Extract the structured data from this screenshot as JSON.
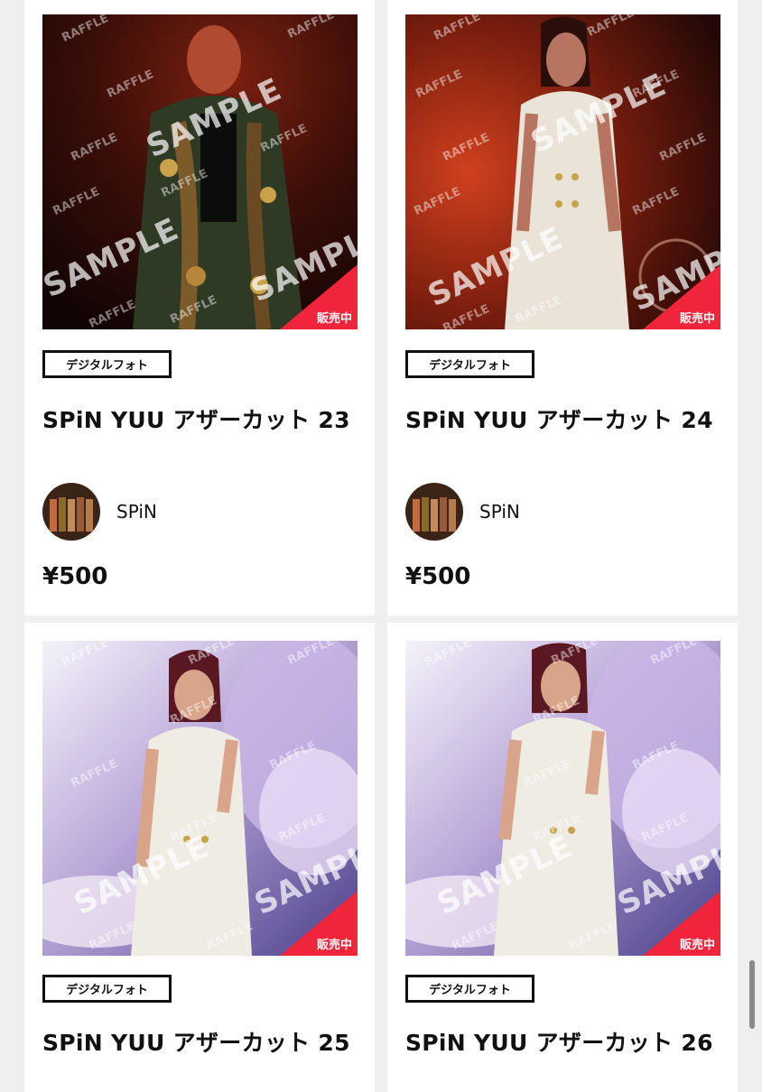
{
  "products": [
    {
      "category": "デジタルフォト",
      "title": "SPiN YUU アザーカット 23",
      "artist": "SPiN",
      "price": "¥500",
      "status": "販売中",
      "watermark_big": "SAMPLE",
      "watermark_small": "RAFFLE",
      "photo_theme": "dark-red"
    },
    {
      "category": "デジタルフォト",
      "title": "SPiN YUU アザーカット 24",
      "artist": "SPiN",
      "price": "¥500",
      "status": "販売中",
      "watermark_big": "SAMPLE",
      "watermark_small": "RAFFLE",
      "photo_theme": "red-white-vest"
    },
    {
      "category": "デジタルフォト",
      "title": "SPiN YUU アザーカット 25",
      "status": "販売中",
      "watermark_big": "SAMPLE",
      "watermark_small": "RAFFLE",
      "photo_theme": "wings-purple"
    },
    {
      "category": "デジタルフォト",
      "title": "SPiN YUU アザーカット 26",
      "status": "販売中",
      "watermark_big": "SAMPLE",
      "watermark_small": "RAFFLE",
      "photo_theme": "wings-purple"
    }
  ],
  "colors": {
    "sale_badge": "#f0243a",
    "card_bg": "#ffffff",
    "page_bg": "#efefef"
  }
}
